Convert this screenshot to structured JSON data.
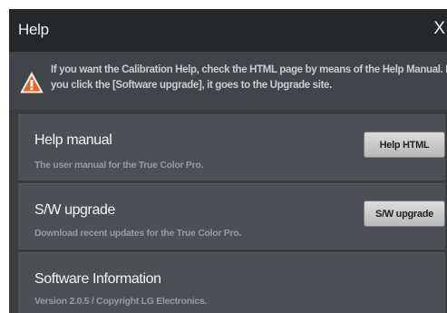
{
  "window": {
    "title": "Help",
    "close_label": "X"
  },
  "notice": {
    "icon": "warning-triangle-icon",
    "line1": "If you want the Calibration Help, check the HTML page by means of the Help Manual. If",
    "line2": "you click the [Software upgrade], it goes to the Upgrade site."
  },
  "panels": [
    {
      "title": "Help manual",
      "subtitle": "The user manual for the True Color Pro.",
      "button_label": "Help HTML"
    },
    {
      "title": "S/W upgrade",
      "subtitle": "Download recent updates for the True Color Pro.",
      "button_label": "S/W upgrade"
    },
    {
      "title": "Software Information",
      "subtitle": "Version 2.0.5 / Copyright LG Electronics."
    }
  ],
  "colors": {
    "titlebar": "#25282b",
    "panel": "#4c4f54",
    "warning_orange": "#e8702a"
  }
}
